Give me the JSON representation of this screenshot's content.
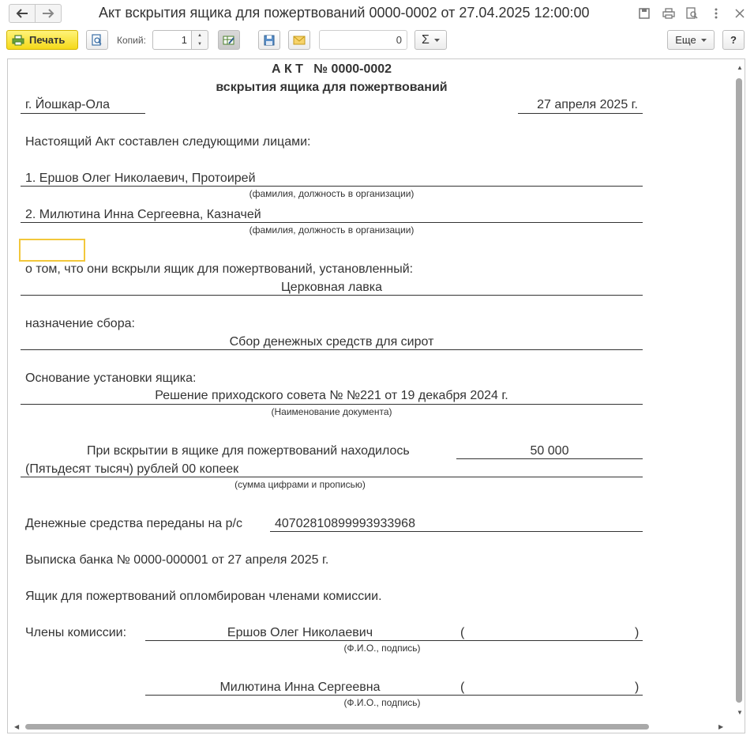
{
  "window": {
    "title": "Акт вскрытия ящика для пожертвований 0000-0002 от 27.04.2025 12:00:00"
  },
  "toolbar": {
    "print_label": "Печать",
    "copies_label": "Копий:",
    "copies_value": "1",
    "sum_value": "0",
    "sigma_label": "Σ",
    "more_label": "Еще",
    "help_label": "?"
  },
  "document": {
    "title_line1": "А К Т   № 0000-0002",
    "title_line2": "вскрытия ящика для пожертвований",
    "city": "г. Йошкар-Ола",
    "date": "27 апреля 2025 г.",
    "intro": "Настоящий Акт составлен следующими лицами:",
    "person1": "1. Ершов Олег Николаевич, Протоирей",
    "person1_hint": "(фамилия, должность в организации)",
    "person2": "2. Милютина Инна Сергеевна, Казначей",
    "person2_hint": "(фамилия, должность в организации)",
    "opened_text": "о том, что они вскрыли ящик для пожертвований, установленный:",
    "location": "Церковная лавка",
    "purpose_label": "назначение сбора:",
    "purpose": "Сбор денежных средств для сирот",
    "basis_label": "Основание установки ящика:",
    "basis": "Решение приходского совета № №221 от 19 декабря 2024 г.",
    "basis_hint": "(Наименование документа)",
    "found_text": "При вскрытии в ящике для пожертвований находилось",
    "amount_number": "50 000",
    "amount_words": "(Пятьдесят тысяч) рублей 00 копеек",
    "amount_hint": "(сумма цифрами и прописью)",
    "account_label": "Денежные средства переданы на р/с",
    "account": "40702810899993933968",
    "bank_statement": "Выписка банка № 0000-000001 от 27 апреля 2025 г.",
    "sealed_text": "Ящик для пожертвований опломбирован членами комиссии.",
    "members_label": "Члены комиссии:",
    "member1": "Ершов Олег Николаевич",
    "member2": "Милютина Инна Сергеевна",
    "sign_open": "(",
    "sign_close": ")",
    "sign_hint": "(Ф.И.О., подпись)"
  }
}
